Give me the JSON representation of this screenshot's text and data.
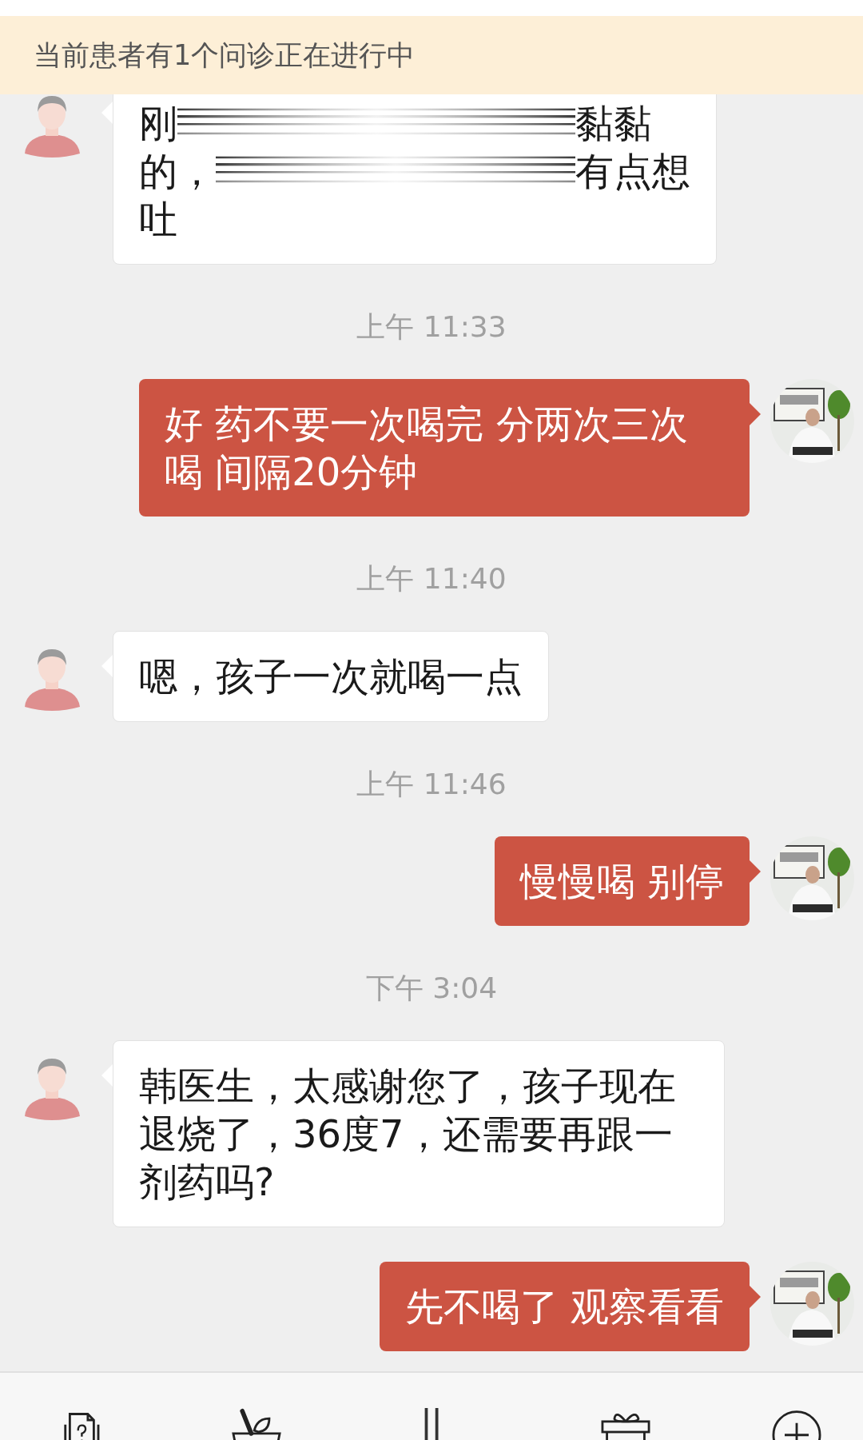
{
  "banner": {
    "text": "当前患者有1个问诊正在进行中"
  },
  "chat": [
    {
      "kind": "incoming_redacted",
      "lines": [
        {
          "start": "刚",
          "end": "黏黏"
        },
        {
          "start": "的，",
          "end": "有点想"
        },
        {
          "start": "吐"
        }
      ]
    },
    {
      "kind": "time",
      "text": "上午 11:33"
    },
    {
      "kind": "outgoing",
      "text": "好 药不要一次喝完  分两次三次喝 间隔20分钟"
    },
    {
      "kind": "time",
      "text": "上午 11:40"
    },
    {
      "kind": "incoming",
      "text": "嗯，孩子一次就喝一点"
    },
    {
      "kind": "time",
      "text": "上午 11:46"
    },
    {
      "kind": "outgoing",
      "text": "慢慢喝 别停"
    },
    {
      "kind": "time",
      "text": "下午 3:04"
    },
    {
      "kind": "incoming",
      "text": "韩医生，太感谢您了，孩子现在退烧了，36度7，还需要再跟一剂药吗?"
    },
    {
      "kind": "outgoing",
      "text": "先不喝了 观察看看"
    }
  ]
}
